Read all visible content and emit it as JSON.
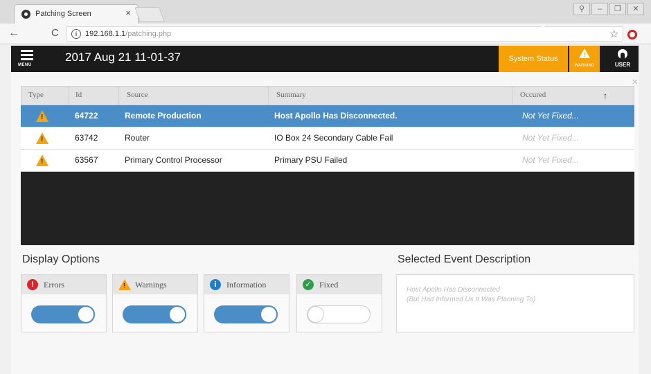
{
  "browser": {
    "tab_title": "Patching Screen",
    "tab_close": "×",
    "url_host": "192.168.1.1",
    "url_path": "/patching.php",
    "back": "←",
    "reload": "C",
    "star": "☆"
  },
  "header": {
    "menu_label": "MENU",
    "datetime": "2017 Aug 21 11-01-37",
    "system_status": "System Status",
    "warning_label": "WARNING",
    "user_label": "USER",
    "accent": "#f4a10a"
  },
  "events": {
    "columns": [
      "Type",
      "Id",
      "Source",
      "Summary",
      "Occured"
    ],
    "rows": [
      {
        "id": "64722",
        "source": "Remote Production",
        "summary": "Host Apollo Has Disconnected.",
        "occured": "Not Yet Fixed...",
        "selected": true
      },
      {
        "id": "63742",
        "source": "Router",
        "summary": "IO Box 24 Secondary Cable Fail",
        "occured": "Not Yet Fixed...",
        "selected": false
      },
      {
        "id": "63567",
        "source": "Primary Control Processor",
        "summary": "Primary PSU Failed",
        "occured": "Not Yet Fixed...",
        "selected": false
      }
    ],
    "selected_color": "#4b8dc7"
  },
  "display_options": {
    "title": "Display Options",
    "options": [
      {
        "label": "Errors",
        "icon": "error-icon",
        "on": true
      },
      {
        "label": "Warnings",
        "icon": "warning-icon",
        "on": true
      },
      {
        "label": "Information",
        "icon": "info-icon",
        "on": true
      },
      {
        "label": "Fixed",
        "icon": "check-icon",
        "on": false
      }
    ]
  },
  "selected_event": {
    "title": "Selected Event Description",
    "line1": "Host Apollo Has Disconnected",
    "line2": "(But Had Informed Us It Was Planning To)"
  }
}
